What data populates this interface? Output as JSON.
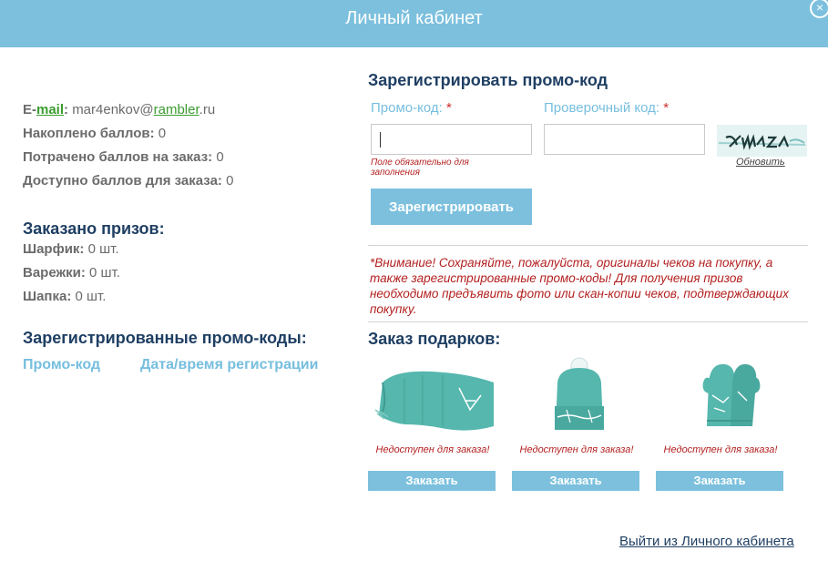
{
  "header": {
    "title": "Личный кабинет",
    "close_symbol": "×"
  },
  "account": {
    "email_label_prefix": "E-",
    "email_label_link": "mail",
    "email_label_suffix": ":",
    "email_user": "mar4enkov@",
    "email_domain_link": "rambler",
    "email_tld": ".ru",
    "points_earned_label": "Накоплено баллов:",
    "points_earned_value": "0",
    "points_spent_label": "Потрачено баллов на заказ:",
    "points_spent_value": "0",
    "points_available_label": "Доступно баллов для заказа:",
    "points_available_value": "0"
  },
  "prizes": {
    "title": "Заказано призов:",
    "items": [
      {
        "label": "Шарфик:",
        "value": "0 шт."
      },
      {
        "label": "Варежки:",
        "value": "0 шт."
      },
      {
        "label": "Шапка:",
        "value": "0 шт."
      }
    ]
  },
  "codes": {
    "title": "Зарегистрированные промо-коды:",
    "columns": [
      "Промо-код",
      "Дата/время регистрации"
    ]
  },
  "register": {
    "title": "Зарегистрировать промо-код",
    "promo_label": "Промо-код:",
    "check_label": "Проверочный код:",
    "required_mark": "*",
    "promo_value": "",
    "check_value": "",
    "error": "Поле обязательно для заполнения",
    "refresh": "Обновить",
    "button": "Зарегистрировать"
  },
  "notice": "*Внимание! Сохраняйте, пожалуйста, оригиналы чеков на покупку, а также зарегистрированные промо-коды! Для получения призов необходимо предъявить фото или скан-копии чеков, подтверждающих покупку.",
  "gifts": {
    "title": "Заказ подарков:",
    "items": [
      {
        "status": "Недоступен для заказа!",
        "button": "Заказать",
        "icon": "scarf-icon"
      },
      {
        "status": "Недоступен для заказа!",
        "button": "Заказать",
        "icon": "hat-icon"
      },
      {
        "status": "Недоступен для заказа!",
        "button": "Заказать",
        "icon": "mittens-icon"
      }
    ]
  },
  "logout": "Выйти из Личного кабинета",
  "colors": {
    "header": "#7cc0de",
    "accent_text": "#76bedf",
    "title_text": "#1f3f63",
    "error_text": "#b32020",
    "product_teal": "#4fb3a9"
  }
}
